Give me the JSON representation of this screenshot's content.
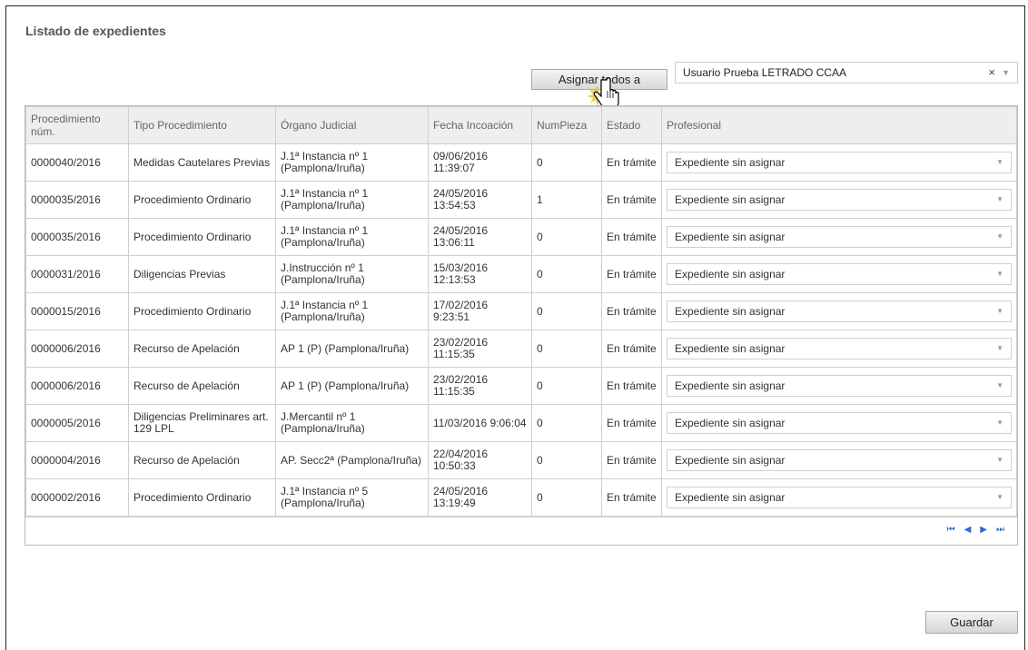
{
  "page": {
    "title": "Listado de expedientes"
  },
  "toolbar": {
    "assign_all_label": "Asignar todos a",
    "user_select_value": "Usuario Prueba LETRADO CCAA",
    "clear_glyph": "×",
    "arrow_glyph": "▼"
  },
  "table": {
    "columns": [
      "Procedimiento núm.",
      "Tipo Procedimiento",
      "Órgano Judicial",
      "Fecha Incoación",
      "NumPieza",
      "Estado",
      "Profesional"
    ],
    "rows": [
      {
        "num": "0000040/2016",
        "tipo": "Medidas Cautelares Previas",
        "organo": "J.1ª Instancia nº 1 (Pamplona/Iruña)",
        "fecha": "09/06/2016 11:39:07",
        "pieza": "0",
        "estado": "En trámite",
        "profesional": "Expediente sin asignar"
      },
      {
        "num": "0000035/2016",
        "tipo": "Procedimiento Ordinario",
        "organo": "J.1ª Instancia nº 1 (Pamplona/Iruña)",
        "fecha": "24/05/2016 13:54:53",
        "pieza": "1",
        "estado": "En trámite",
        "profesional": "Expediente sin asignar"
      },
      {
        "num": "0000035/2016",
        "tipo": "Procedimiento Ordinario",
        "organo": "J.1ª Instancia nº 1 (Pamplona/Iruña)",
        "fecha": "24/05/2016 13:06:11",
        "pieza": "0",
        "estado": "En trámite",
        "profesional": "Expediente sin asignar"
      },
      {
        "num": "0000031/2016",
        "tipo": "Diligencias Previas",
        "organo": "J.Instrucción nº 1 (Pamplona/Iruña)",
        "fecha": "15/03/2016 12:13:53",
        "pieza": "0",
        "estado": "En trámite",
        "profesional": "Expediente sin asignar"
      },
      {
        "num": "0000015/2016",
        "tipo": "Procedimiento Ordinario",
        "organo": "J.1ª Instancia nº 1 (Pamplona/Iruña)",
        "fecha": "17/02/2016 9:23:51",
        "pieza": "0",
        "estado": "En trámite",
        "profesional": "Expediente sin asignar"
      },
      {
        "num": "0000006/2016",
        "tipo": "Recurso de Apelación",
        "organo": "AP 1 (P) (Pamplona/Iruña)",
        "fecha": "23/02/2016 11:15:35",
        "pieza": "0",
        "estado": "En trámite",
        "profesional": "Expediente sin asignar"
      },
      {
        "num": "0000006/2016",
        "tipo": "Recurso de Apelación",
        "organo": "AP 1 (P) (Pamplona/Iruña)",
        "fecha": "23/02/2016 11:15:35",
        "pieza": "0",
        "estado": "En trámite",
        "profesional": "Expediente sin asignar"
      },
      {
        "num": "0000005/2016",
        "tipo": "Diligencias Preliminares art. 129 LPL",
        "organo": "J.Mercantil nº 1 (Pamplona/Iruña)",
        "fecha": "11/03/2016 9:06:04",
        "pieza": "0",
        "estado": "En trámite",
        "profesional": "Expediente sin asignar"
      },
      {
        "num": "0000004/2016",
        "tipo": "Recurso de Apelación",
        "organo": "AP. Secc2ª (Pamplona/Iruña)",
        "fecha": "22/04/2016 10:50:33",
        "pieza": "0",
        "estado": "En trámite",
        "profesional": "Expediente sin asignar"
      },
      {
        "num": "0000002/2016",
        "tipo": "Procedimiento Ordinario",
        "organo": "J.1ª Instancia nº 5 (Pamplona/Iruña)",
        "fecha": "24/05/2016 13:19:49",
        "pieza": "0",
        "estado": "En trámite",
        "profesional": "Expediente sin asignar"
      }
    ]
  },
  "pager": {
    "first": "⏮",
    "prev": "◀",
    "next": "▶",
    "last": "⏭"
  },
  "footer": {
    "save_label": "Guardar"
  },
  "colors": {
    "pager": "#2a6dd6",
    "header_bg": "#eeeeee"
  }
}
